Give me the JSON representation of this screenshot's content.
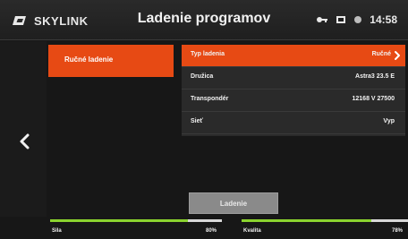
{
  "header": {
    "brand": "SKYLINK",
    "title": "Ladenie programov",
    "time": "14:58",
    "icons": [
      "key-icon",
      "card-icon",
      "dot-icon"
    ]
  },
  "left_menu": {
    "items": [
      "Ručné ladenie"
    ]
  },
  "fields": [
    {
      "key": "Typ ladenia",
      "value": "Ručné",
      "selected": true
    },
    {
      "key": "Družica",
      "value": "Astra3 23.5 E",
      "selected": false
    },
    {
      "key": "Transpondér",
      "value": "12168 V 27500",
      "selected": false
    },
    {
      "key": "Sieť",
      "value": "Vyp",
      "selected": false
    }
  ],
  "actions": {
    "scan_button": "Ladenie"
  },
  "signal": {
    "strength": {
      "label": "Sila",
      "value": "80%",
      "percent": 80
    },
    "quality": {
      "label": "Kvalita",
      "value": "78%",
      "percent": 78
    }
  },
  "colors": {
    "accent": "#e74a14",
    "meter_fill": "#8bd32f"
  }
}
